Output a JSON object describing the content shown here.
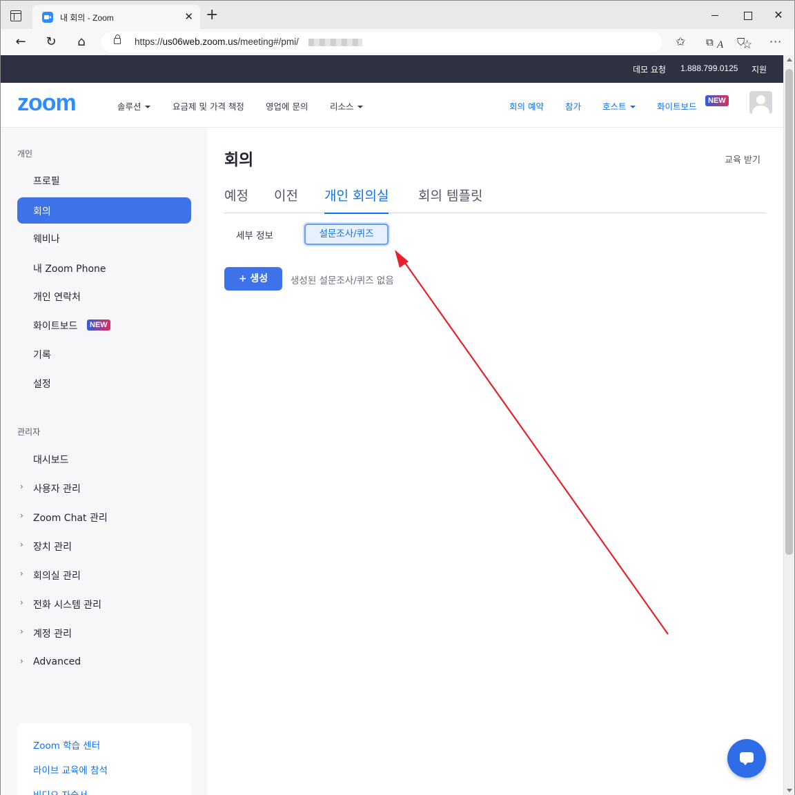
{
  "browser": {
    "tab_title": "내 회의 - Zoom",
    "tab_close": "✕",
    "new_tab": "+",
    "url_prefix": "https://",
    "url_host": "us06web.zoom.us",
    "url_path": "/meeting#/pmi/"
  },
  "topstrip": {
    "demo": "데모 요청",
    "phone": "1.888.799.0125",
    "support": "지원"
  },
  "nav": {
    "logo": "zoom",
    "solutions": "솔루션",
    "pricing": "요금제 및 가격 책정",
    "sales": "영업에 문의",
    "resources": "리소스",
    "schedule": "회의 예약",
    "join": "참가",
    "host": "호스트",
    "whiteboard": "화이트보드",
    "new_badge": "NEW"
  },
  "sidebar": {
    "personal_title": "개인",
    "personal_items": [
      "프로필",
      "회의",
      "웨비나",
      "내 Zoom Phone",
      "개인 연락처",
      "화이트보드",
      "기록",
      "설정"
    ],
    "new_badge": "NEW",
    "admin_title": "관리자",
    "admin_items": [
      "대시보드",
      "사용자 관리",
      "Zoom Chat 관리",
      "장치 관리",
      "회의실 관리",
      "전화 시스템 관리",
      "계정 관리",
      "Advanced"
    ],
    "links": [
      "Zoom 학습 센터",
      "라이브 교육에 참석",
      "비디오 자습서"
    ]
  },
  "main": {
    "title": "회의",
    "training": "교육 받기",
    "tabs": [
      "예정",
      "이전",
      "개인 회의실",
      "회의 템플릿"
    ],
    "subtabs": [
      "세부 정보",
      "설문조사/퀴즈"
    ],
    "create_label": "+  생성",
    "empty_message": "생성된 설문조사/퀴즈 없음"
  },
  "colors": {
    "accent": "#0e72ed",
    "active_item": "#3d72e8",
    "annotation_arrow": "#e8202a"
  }
}
